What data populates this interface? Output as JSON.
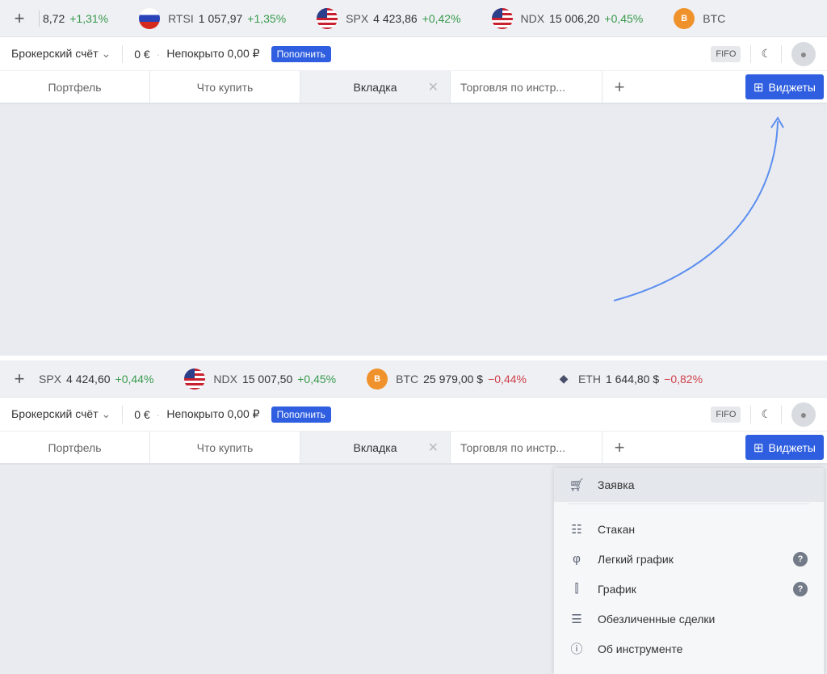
{
  "panels": [
    {
      "ticker": [
        {
          "symbol": "",
          "price": "8,72",
          "change": "+1,31%",
          "dir": "up",
          "flag": "none"
        },
        {
          "symbol": "RTSI",
          "price": "1 057,97",
          "change": "+1,35%",
          "dir": "up",
          "flag": "ru"
        },
        {
          "symbol": "SPX",
          "price": "4 423,86",
          "change": "+0,42%",
          "dir": "up",
          "flag": "us"
        },
        {
          "symbol": "NDX",
          "price": "15 006,20",
          "change": "+0,45%",
          "dir": "up",
          "flag": "us"
        },
        {
          "symbol": "BTC",
          "price": "",
          "change": "",
          "dir": "up",
          "flag": "btc"
        }
      ]
    },
    {
      "ticker": [
        {
          "symbol": "SPX",
          "price": "4 424,60",
          "change": "+0,44%",
          "dir": "up",
          "flag": "none"
        },
        {
          "symbol": "NDX",
          "price": "15 007,50",
          "change": "+0,45%",
          "dir": "up",
          "flag": "us"
        },
        {
          "symbol": "BTC",
          "price": "25 979,00 $",
          "change": "−0,44%",
          "dir": "dn",
          "flag": "btc"
        },
        {
          "symbol": "ETH",
          "price": "1 644,80 $",
          "change": "−0,82%",
          "dir": "dn",
          "flag": "eth"
        }
      ]
    }
  ],
  "account": {
    "label": "Брокерский счёт",
    "balance": "0 €",
    "uncovered": "Непокрыто 0,00 ₽",
    "topup": "Пополнить",
    "fifo": "FIFO"
  },
  "tabs": [
    "Портфель",
    "Что купить",
    "Вкладка",
    "Торговля по инстр..."
  ],
  "widgets_label": "Виджеты",
  "menu": {
    "items": [
      {
        "label": "Заявка",
        "icon": "cart-icon"
      },
      {
        "label": "Стакан",
        "icon": "order-book-icon"
      },
      {
        "label": "Легкий график",
        "icon": "light-chart-icon",
        "help": true
      },
      {
        "label": "График",
        "icon": "candle-chart-icon",
        "help": true
      },
      {
        "label": "Обезличенные сделки",
        "icon": "list-icon"
      },
      {
        "label": "Об инструменте",
        "icon": "info-icon"
      }
    ]
  },
  "colors": {
    "accent": "#2f5fe0",
    "up": "#3a9a4c",
    "down": "#d0404a"
  }
}
